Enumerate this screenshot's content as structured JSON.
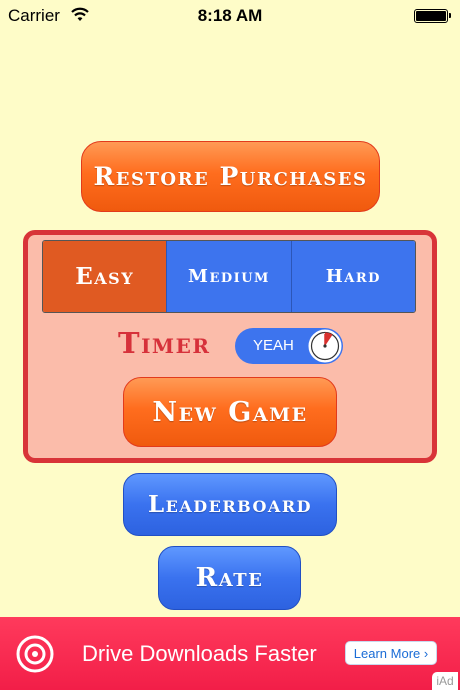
{
  "status_bar": {
    "carrier": "Carrier",
    "time": "8:18 AM"
  },
  "buttons": {
    "restore": "Restore Purchases",
    "new_game": "New Game",
    "leaderboard": "Leaderboard",
    "rate": "Rate"
  },
  "difficulty": {
    "options": [
      "Easy",
      "Medium",
      "Hard"
    ],
    "selected": "Easy"
  },
  "timer": {
    "label": "Timer",
    "toggle_text": "YEAH",
    "enabled": true
  },
  "ad": {
    "headline": "Drive Downloads Faster",
    "cta": "Learn More ›",
    "badge": "iAd"
  },
  "colors": {
    "background": "#fefcc8",
    "orange": "#ff6d1e",
    "blue": "#3d74ee",
    "panel": "#fbbcaa",
    "panel_border": "#d83438",
    "ad": "#f21e48"
  }
}
